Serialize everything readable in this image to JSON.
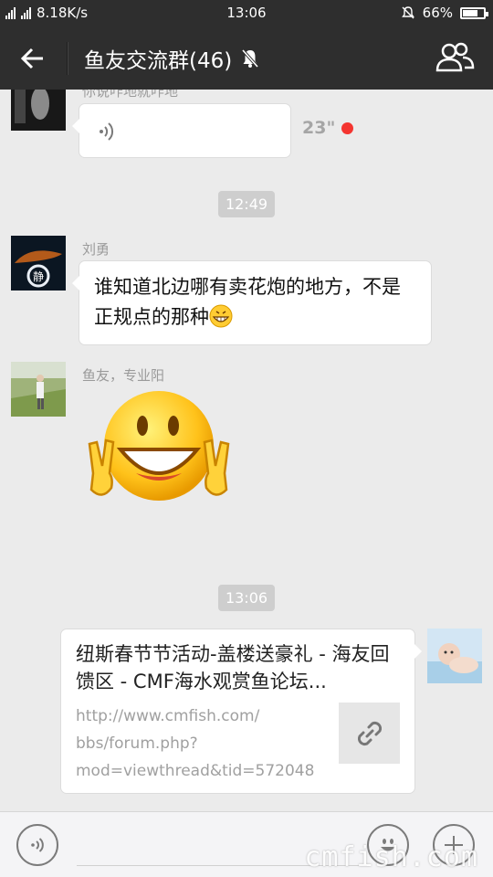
{
  "status_bar": {
    "network_labels": "2G 4G 4G",
    "speed": "8.18K/s",
    "time": "13:06",
    "battery": "66%",
    "battery_level": 0.66
  },
  "header": {
    "title": "鱼友交流群(46)",
    "muted_icon": "bell-off-icon",
    "back_icon": "arrow-left-icon",
    "group_icon": "group-members-icon"
  },
  "messages": {
    "voice": {
      "sender_partial": "你说咋地就咋地",
      "duration": "23\"",
      "unread_color": "#f43530"
    },
    "timestamp_1": "12:49",
    "text_msg": {
      "sender": "刘勇",
      "text": "谁知道北边哪有卖花炮的地方，不是正规点的那种",
      "emoji": "grin-emoji"
    },
    "sticker_msg": {
      "sender": "鱼友，专业阳",
      "sticker": "smiley-victory-hands-sticker"
    },
    "timestamp_2": "13:06",
    "link_msg": {
      "title": "纽斯春节节活动-盖楼送豪礼 - 海友回馈区 - CMF海水观赏鱼论坛...",
      "url_line1": "http://www.cmfish.com/",
      "url_line2": "bbs/forum.php?",
      "url_line3": "mod=viewthread&tid=572048",
      "thumb_icon": "link-icon"
    }
  },
  "input_bar": {
    "voice_icon": "voice-toggle-icon",
    "emoji_icon": "emoji-icon",
    "plus_icon": "plus-icon",
    "watermark": "cmfish.com"
  },
  "colors": {
    "header_bg": "#2e2e2e",
    "chat_bg": "#ebebeb",
    "bubble_bg": "#ffffff",
    "timestamp_bg": "#cecece"
  }
}
